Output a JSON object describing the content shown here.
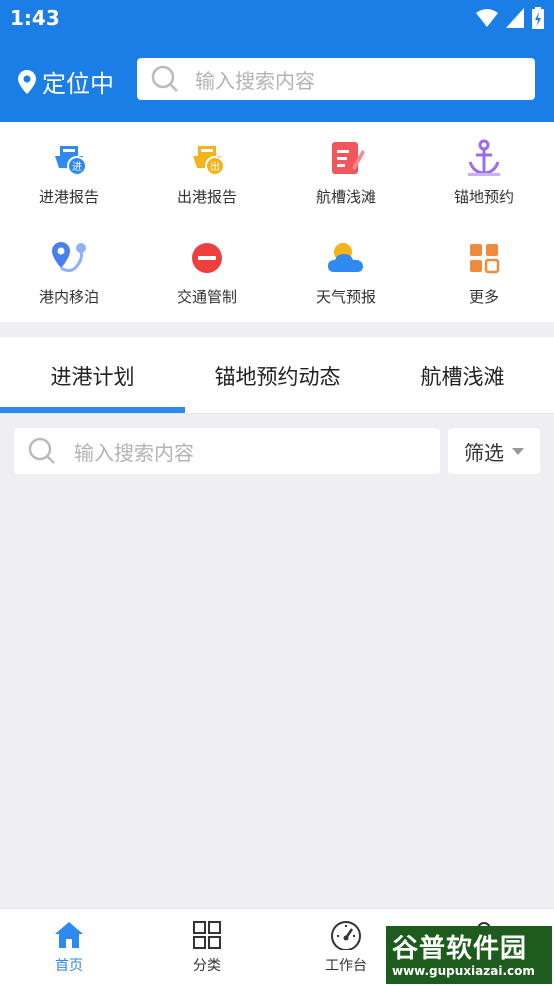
{
  "status": {
    "time": "1:43"
  },
  "header": {
    "location": "定位中",
    "search_placeholder": "输入搜索内容"
  },
  "grid": [
    {
      "label": "进港报告",
      "icon": "ship-in-icon",
      "color": "#2e8af0"
    },
    {
      "label": "出港报告",
      "icon": "ship-out-icon",
      "color": "#f5b21b"
    },
    {
      "label": "航槽浅滩",
      "icon": "edit-doc-icon",
      "color": "#f0565c"
    },
    {
      "label": "锚地预约",
      "icon": "anchor-icon",
      "color": "#9b6cf0"
    },
    {
      "label": "港内移泊",
      "icon": "map-route-icon",
      "color": "#4a7ef0"
    },
    {
      "label": "交通管制",
      "icon": "no-entry-icon",
      "color": "#ee3f3f"
    },
    {
      "label": "天气预报",
      "icon": "weather-icon",
      "color": "#f5b21b"
    },
    {
      "label": "更多",
      "icon": "more-grid-icon",
      "color": "#f08a3c"
    }
  ],
  "tabs": [
    "进港计划",
    "锚地预约动态",
    "航槽浅滩"
  ],
  "list_search": {
    "placeholder": "输入搜索内容",
    "filter_label": "筛选"
  },
  "nav": [
    {
      "label": "首页",
      "icon": "home-icon"
    },
    {
      "label": "分类",
      "icon": "category-icon"
    },
    {
      "label": "工作台",
      "icon": "dashboard-icon"
    },
    {
      "label": "",
      "icon": "user-icon"
    }
  ],
  "watermark": {
    "text": "谷普软件园",
    "url": "www.gupuxiazai.com"
  }
}
